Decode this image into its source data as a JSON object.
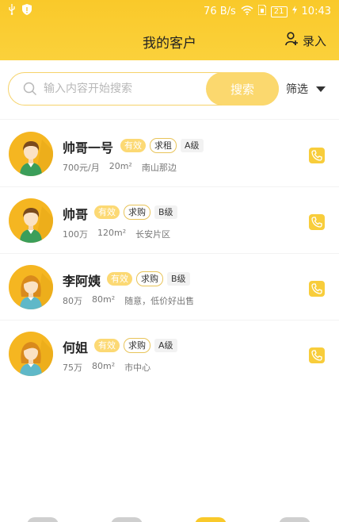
{
  "status_bar": {
    "net_speed": "76 B/s",
    "battery": "21",
    "time": "10:43"
  },
  "header": {
    "title": "我的客户",
    "record_label": "录入"
  },
  "search": {
    "placeholder": "输入内容开始搜索",
    "button_label": "搜索",
    "filter_label": "筛选"
  },
  "colors": {
    "brand": "#f9c92a",
    "tag_valid": "#fcd974",
    "phone": "#f8cd3b"
  },
  "customers": [
    {
      "name": "帅哥一号",
      "status": "有效",
      "type": "求租",
      "level": "A级",
      "price": "700元/月",
      "area": "20m²",
      "location": "南山那边",
      "avatar": "male-avatar"
    },
    {
      "name": "帅哥",
      "status": "有效",
      "type": "求购",
      "level": "B级",
      "price": "100万",
      "area": "120m²",
      "location": "长安片区",
      "avatar": "male-avatar"
    },
    {
      "name": "李阿姨",
      "status": "有效",
      "type": "求购",
      "level": "B级",
      "price": "80万",
      "area": "80m²",
      "location": "随意，低价好出售",
      "avatar": "female-avatar"
    },
    {
      "name": "何姐",
      "status": "有效",
      "type": "求购",
      "level": "A级",
      "price": "75万",
      "area": "80m²",
      "location": "市中心",
      "avatar": "female-avatar"
    }
  ]
}
